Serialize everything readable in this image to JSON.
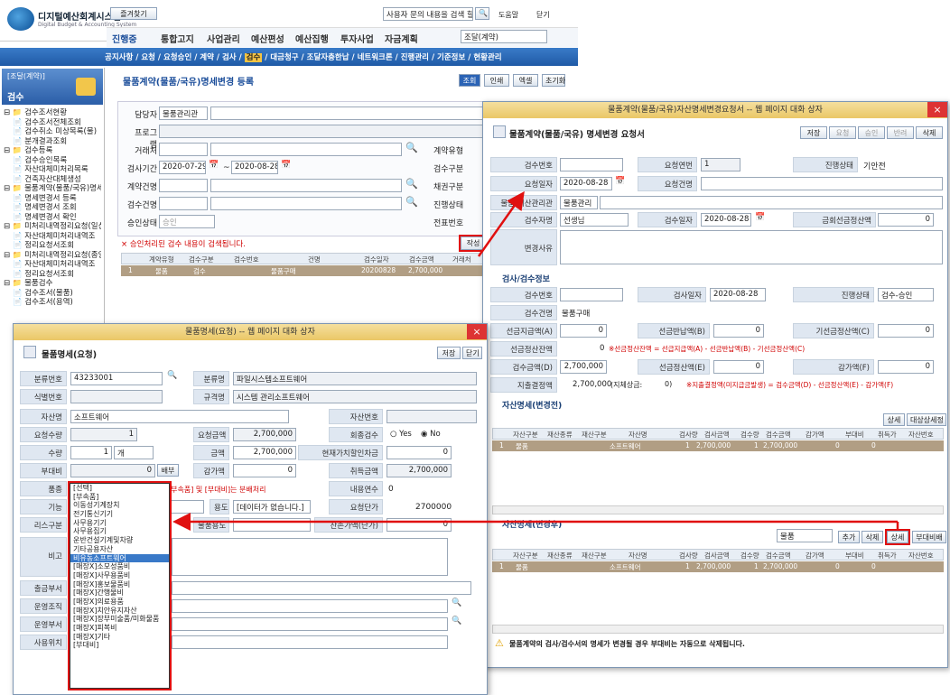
{
  "app": {
    "logo_title": "디지털예산회계시스템",
    "logo_sub": "Digital Budget & Accounting System",
    "favorites_label": "즐겨찾기",
    "ticker": "사용자 문의 내용을 검색 할",
    "help": "도움말",
    "close": "닫기",
    "org_select": "조달(계약)"
  },
  "top_menu": [
    "진행중",
    "통합고지",
    "사업관리",
    "예산편성",
    "예산집행",
    "투자사업",
    "자금계획"
  ],
  "sub_menu": [
    "공지사항",
    "요청",
    "요청승인",
    "계약",
    "검사",
    "검수",
    "대금청구",
    "조달자충한납",
    "네트워크론",
    "진행관리",
    "기준정보",
    "현황관리"
  ],
  "sidebar": {
    "org": "[조달(계약)]",
    "section": "검수",
    "tree": [
      "검수조서현황",
      "검수조서전체조회",
      "검수취소 미상목록(물)",
      "분개결과조회",
      "검수등록",
      "검수승인목록",
      "자산대체미처리목록",
      "건축자산대체생성",
      "물품계약(물품/국유)명세변",
      "명세변경서 등록",
      "명세변경서 조회",
      "명세변경서 확인",
      "미처리내역정리요청(일선)",
      "자산대체미처리내역조",
      "정리요청서조회",
      "미처리내역정리요청(종앙)",
      "자산대체미처리내역조",
      "정리요청서조회",
      "물품검수",
      "검수조서(물품)",
      "검수조서(용역)"
    ]
  },
  "main": {
    "title": "물품계약(물품/국유)명세변경 등록",
    "btn_search": "조회",
    "btn_print": "인쇄",
    "btn_excel": "엑셀",
    "btn_init": "초기화",
    "labels": {
      "manager": "담당자",
      "program": "프로그램",
      "vendor": "거래처",
      "insp_period": "검사기간",
      "contract_name": "계약건명",
      "insp_name": "검수건명",
      "approval": "승인상태",
      "contract_type": "계약유형",
      "insp_type": "검수구분",
      "bond_type": "채권구분",
      "progress": "진행상태",
      "doc_no": "전표번호"
    },
    "manager_val": "물품관리관",
    "date_from": "2020-07-29",
    "date_to": "2020-08-28",
    "approval_val": "승인",
    "notice": "× 승인처리된 검수 내용이 검색됩니다.",
    "write_btn": "작성",
    "grid_cols": [
      "계약유형",
      "검수구분",
      "검수번호",
      "건명",
      "검수일자",
      "검수금액",
      "거래처"
    ],
    "grid_row": [
      "1",
      "물품",
      "검수",
      "",
      "물품구매",
      "20200828",
      "2,700,000",
      ""
    ]
  },
  "dlg1": {
    "title": "물품명세(요청) -- 웹 페이지 대화 상자",
    "header": "물품명세(요청)",
    "save": "저장",
    "close": "닫기",
    "labels": {
      "class_no": "분류번호",
      "class_name": "분류명",
      "ident_no": "식별번호",
      "spec": "규격명",
      "asset_name": "자산명",
      "asset_no": "자산번호",
      "req_qty": "요청수량",
      "req_amt": "요청금액",
      "return_ok": "회종검수",
      "qty": "수량",
      "amount": "금액",
      "current_price": "현재가치할인차금",
      "aux_cost": "부대비",
      "depreciation": "감가액",
      "acq_amt": "취득금액",
      "item": "품종",
      "useful_life": "내용연수",
      "function": "기능",
      "usage": "용도",
      "req_unit_price": "요청단가",
      "lease": "리스구분",
      "item_usage": "물품용도",
      "resale": "잔존가액(단가)",
      "remark": "비고",
      "dept": "출금부서",
      "operator": "운영조직",
      "op_dept": "운영부서",
      "location": "사용위치"
    },
    "class_no": "43233001",
    "class_name": "파일시스템소프트웨어",
    "spec": "시스템 관리소프트웨어",
    "asset_name": "소프트웨어",
    "req_qty": "1",
    "req_amt": "2,700,000",
    "yes": "Yes",
    "no": "No",
    "qty": "1",
    "unit": "개",
    "amount": "2,700,000",
    "current_price": "0",
    "aux_cost": "0",
    "aux_btn": "배부",
    "depreciation": "0",
    "acq_amt": "2,700,000",
    "useful_life": "0",
    "item_hint": "[부속품] 및 [부대비]는 분배처리",
    "usage_val": "[데이터가 없습니다.]",
    "unit_price": "2700000",
    "resale_val": "0",
    "dropdown": [
      "[선택]",
      "[부속품]",
      "이동성기계장치",
      "전기통신기기",
      "사무용기기",
      "사무용집기",
      "운반건설기계및차량",
      "기타공용자산",
      "비유동소프트웨어",
      "[매장X]소모성품비",
      "[매장X]사무용품비",
      "[매장X]홍보물품비",
      "[매장X]간행물비",
      "[매장X]의료용품",
      "[매장X]치안유지자산",
      "[매장X]장부미술품/미화물품",
      "[매장X]피복비",
      "[매장X]기타",
      "[부대비]"
    ],
    "dropdown_selected": 8
  },
  "dlg2": {
    "title": "물품계약(물품/국유)자산명세변경요청서 -- 웹 페이지 대화 상자",
    "header": "물품계약(물품/국유) 명세변경 요청서",
    "toolbar": [
      "저장",
      "요청",
      "승인",
      "반려",
      "삭제"
    ],
    "labels": {
      "insp_no": "검수번호",
      "req_seq": "요청연번",
      "progress": "진행상태",
      "req_date": "요청일자",
      "req_name": "요청건명",
      "manager": "물품/예산관리관",
      "inspector": "검수자명",
      "insp_date": "검수일자",
      "prepay_amt": "금회선금정산액",
      "reason": "변경사유"
    },
    "req_seq": "1",
    "progress": "기안전",
    "req_date": "2020-08-28",
    "manager_val": "물품관리",
    "inspector": "선생님",
    "insp_date": "2020-08-28",
    "prepay": "0",
    "sec_insp": "검사/검수정보",
    "insp": {
      "insp_no": "검수번호",
      "insp_date_l": "검사일자",
      "insp_date": "2020-08-28",
      "progress_l": "진행상태",
      "progress": "검수-승인",
      "name_l": "검수건명",
      "name": "물품구매",
      "a_l": "선금지급액(A)",
      "a": "0",
      "b_l": "선금반납액(B)",
      "b": "0",
      "c_l": "기선금정산액(C)",
      "c": "0",
      "bal_l": "선금정산잔액",
      "bal": "0",
      "bal_note": "※선금정산잔액 = 선급지급액(A) - 선금반납액(B) - 기선금정산액(C)",
      "d_l": "검수금액(D)",
      "d": "2,700,000",
      "e_l": "선금정산액(E)",
      "e": "0",
      "f_l": "감가액(F)",
      "f": "0",
      "pay_l": "지출결정액",
      "pay": "2,700,000",
      "pay_mid": "(지체상금:",
      "pay_mid_v": "0)",
      "pay_note": "※지출결정액(미지급금발생) = 검수금액(D) - 선금정산액(E) - 감가액(F)"
    },
    "sec_before": "자산명세(변경전)",
    "btn_detail": "상세",
    "btn_target": "대상상세정",
    "cols": [
      "자산구분",
      "재산종류",
      "재산구분",
      "자산명",
      "검사량",
      "검사금액",
      "검수량",
      "검수금액",
      "감가액",
      "부대비",
      "취득가",
      "자산번호"
    ],
    "row": [
      "1",
      "물품",
      "",
      "",
      "소프트웨어",
      "1",
      "2,700,000",
      "1",
      "2,700,000",
      "0",
      "0"
    ],
    "sec_after": "자산명세(변경후)",
    "after_select": "물품",
    "btn_add": "추가",
    "btn_del": "삭제",
    "btn_aux": "부대비배",
    "warn": "물품계약의 검사/검수서의 명세가 변경될 경우 부대비는 자동으로 삭제됩니다."
  }
}
